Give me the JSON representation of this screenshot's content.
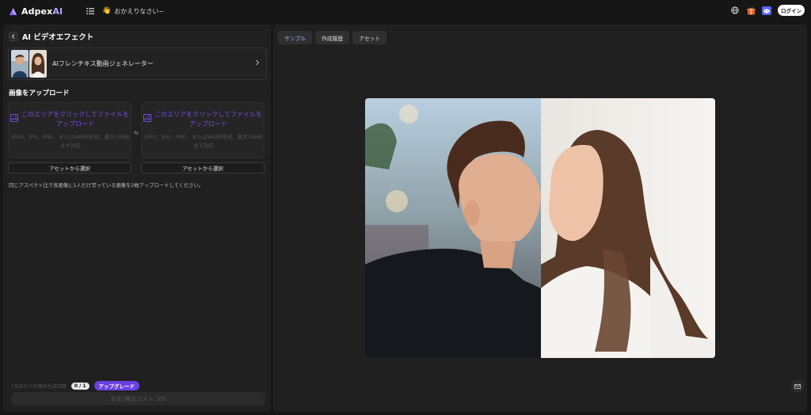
{
  "topbar": {
    "brand_prefix": "Adpex",
    "brand_suffix": "AI",
    "greeting": "おかえりなさい~",
    "login": "ログイン"
  },
  "left": {
    "title": "AI ビデオエフェクト",
    "template_name": "AIフレンチキス動画ジェネレーター",
    "upload_section": "画像をアップロード",
    "upload_main": "このエリアをクリックしてファイルをアップロード",
    "upload_sub": "JPEG、JPG、PNG、またはWEBP形式、最大10MBまで対応",
    "asset_select": "アセットから選択",
    "note": "同じアスペクト比で各画像に1人だけ写っている画像を2枚アップロードしてください。",
    "free_label": "1日あたりの無料生成回数",
    "free_count": "0 / 1",
    "upgrade": "アップグレード",
    "generate": "生成 (推定コスト: 15)"
  },
  "right": {
    "tabs": [
      "サンプル",
      "作成履歴",
      "アセット"
    ]
  },
  "colors": {
    "accent": "#6a3fe0",
    "panel": "#202020",
    "background": "#161616"
  }
}
